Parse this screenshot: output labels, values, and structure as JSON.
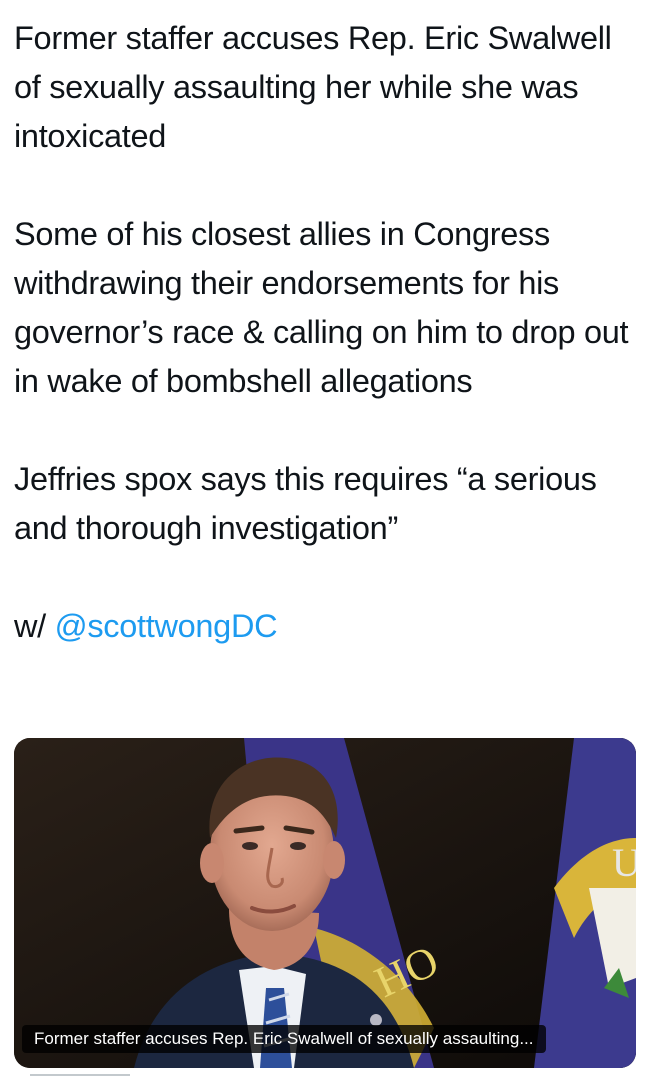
{
  "tweet": {
    "paragraphs": [
      "Former staffer accuses Rep. Eric Swalwell of sexually assaulting her while she was intoxicated",
      "Some of his closest allies in Congress withdrawing their endorsements for his governor’s race & calling on him to drop out in wake of bombshell allegations",
      "Jeffries spox says this requires “a serious and thorough investigation”"
    ],
    "credit_prefix": "w/",
    "mention": "@scottwongDC"
  },
  "link_card": {
    "caption": "Former staffer accuses Rep. Eric Swalwell of sexually assaulting..."
  },
  "colors": {
    "text": "#0f1419",
    "link": "#1d9bf0",
    "background": "#ffffff"
  }
}
